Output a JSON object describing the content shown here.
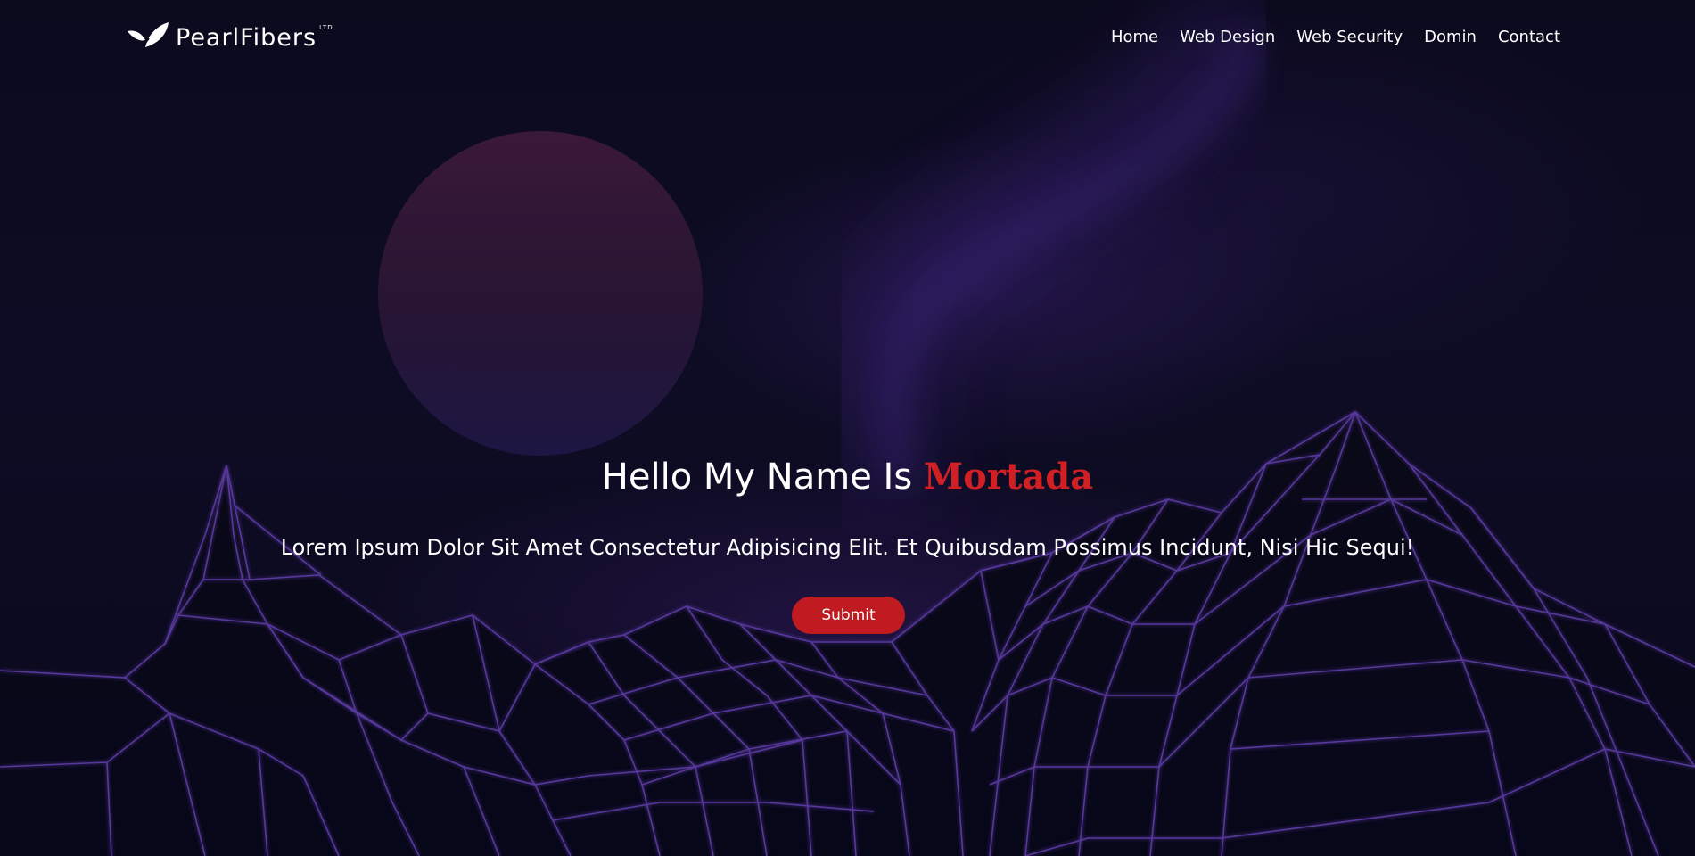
{
  "header": {
    "logo_text": "PearlFibers",
    "logo_superscript": "LTD",
    "nav": [
      "Home",
      "Web Design",
      "Web Security",
      "Domin",
      "Contact"
    ]
  },
  "hero": {
    "title_prefix": "Hello My Name Is ",
    "title_name": "Mortada",
    "text": "Lorem Ipsum Dolor Sit Amet Consectetur Adipisicing Elit. Et Quibusdam Possimus Incidunt, Nisi Hic Sequi!",
    "button_label": "Submit"
  },
  "colors": {
    "background": "#0b0a1c",
    "accent": "#c01b20",
    "name_highlight": "#d12024",
    "wireframe": "#5a3aa0"
  }
}
